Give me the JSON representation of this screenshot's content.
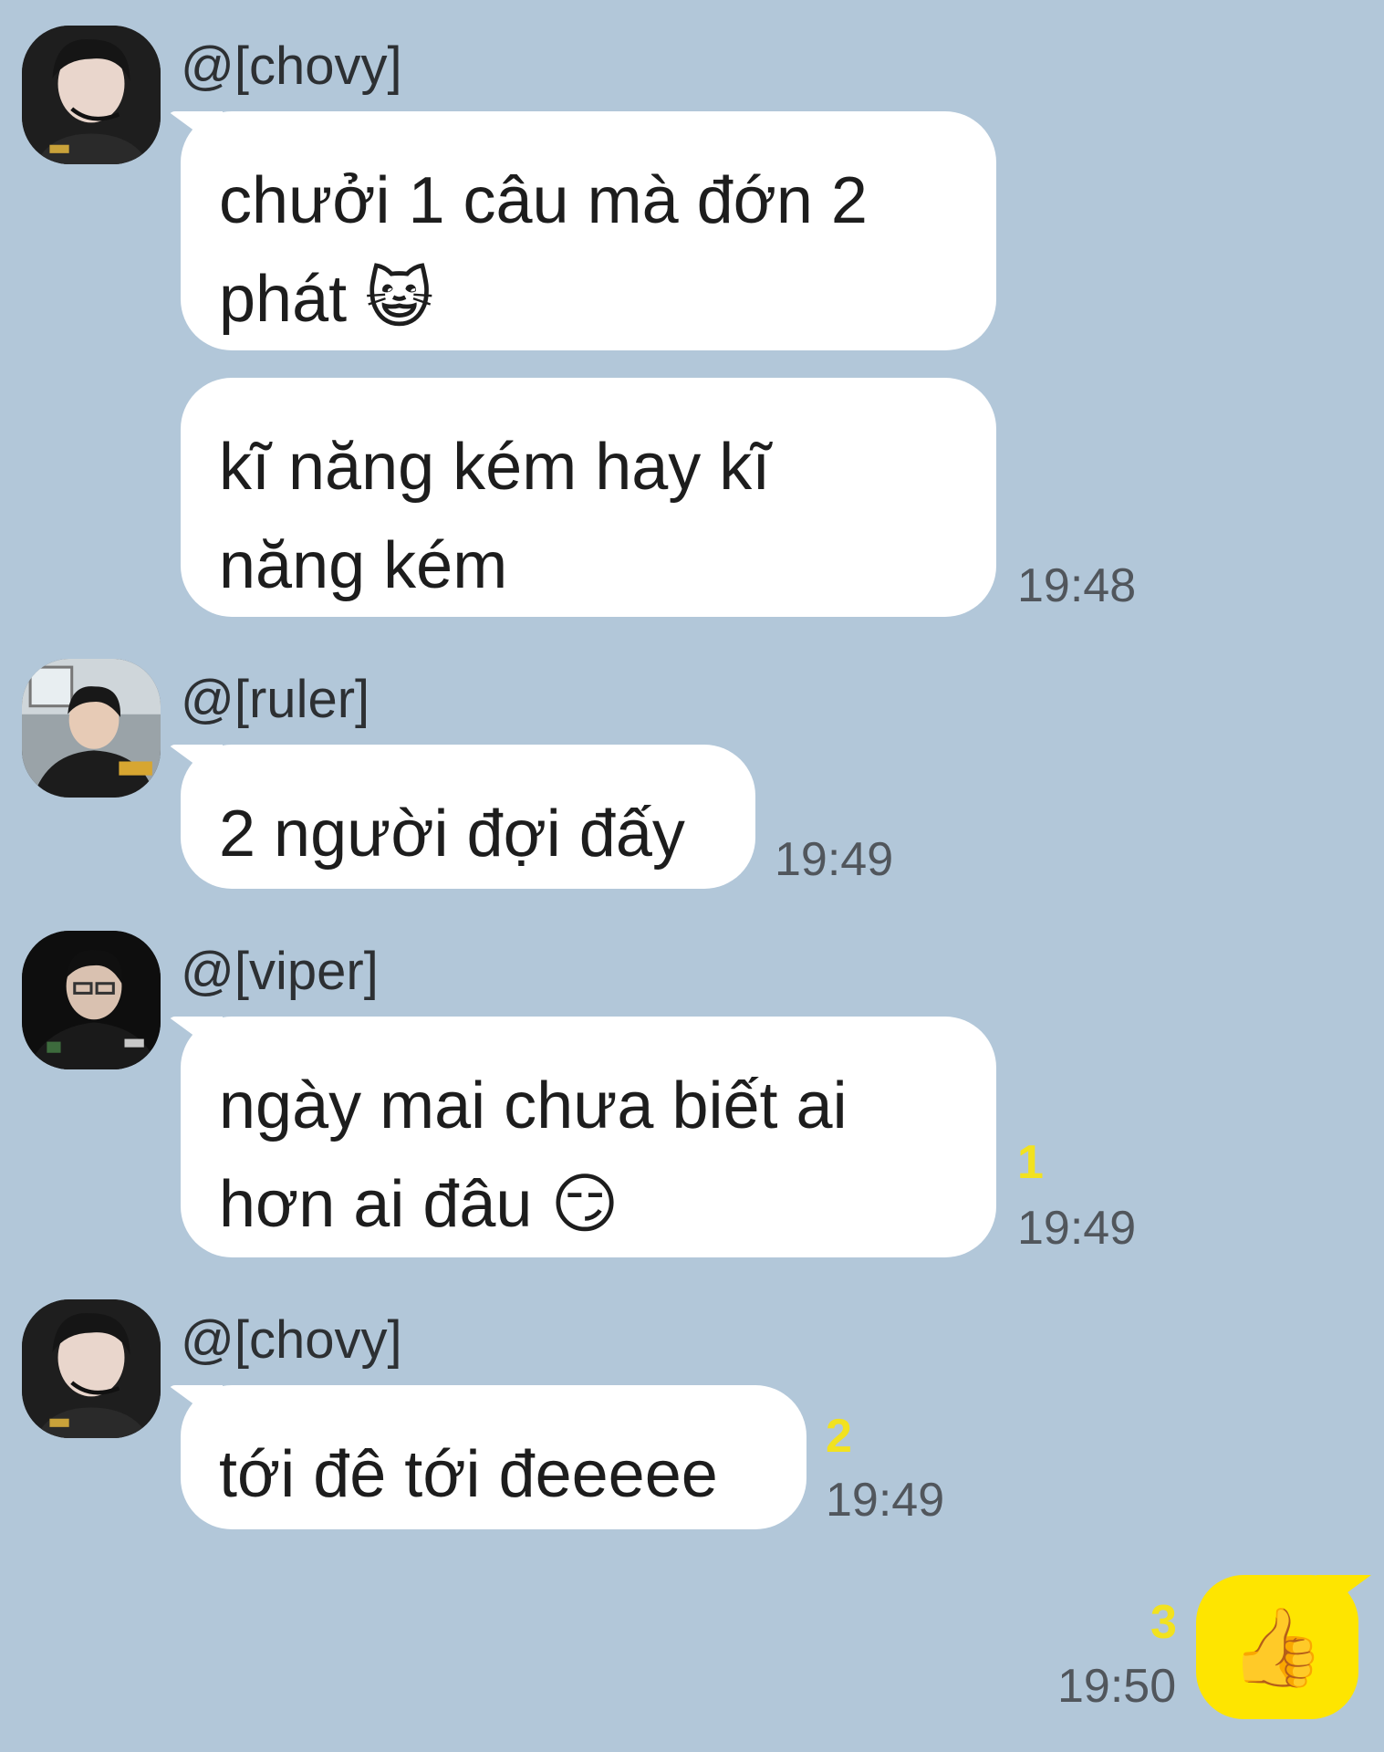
{
  "messages": [
    {
      "sender": "@[chovy]",
      "avatar": "chovy-avatar",
      "bubbles": [
        {
          "lines": [
            "chưởi 1 câu mà đớn 2",
            "phát 😺"
          ]
        },
        {
          "lines": [
            "kĩ năng kém hay kĩ",
            "năng kém"
          ]
        }
      ],
      "time": "19:48"
    },
    {
      "sender": "@[ruler]",
      "avatar": "ruler-avatar",
      "bubbles": [
        {
          "lines": [
            "2 người đợi đấy"
          ]
        }
      ],
      "time": "19:49"
    },
    {
      "sender": "@[viper]",
      "avatar": "viper-avatar",
      "bubbles": [
        {
          "lines": [
            "ngày mai chưa biết ai",
            "hơn ai đâu 😏"
          ]
        }
      ],
      "unread": "1",
      "time": "19:49"
    },
    {
      "sender": "@[chovy]",
      "avatar": "chovy-avatar",
      "bubbles": [
        {
          "lines": [
            "tới đê tới đeeeee"
          ]
        }
      ],
      "unread": "2",
      "time": "19:49"
    }
  ],
  "my_message": {
    "content": "👍",
    "icon": "thumbs-up-icon",
    "unread": "3",
    "time": "19:50"
  },
  "colors": {
    "background": "#b2c7d9",
    "bubble_other": "#ffffff",
    "bubble_mine": "#fee500",
    "unread": "#f2e21f",
    "time": "#51565c"
  }
}
